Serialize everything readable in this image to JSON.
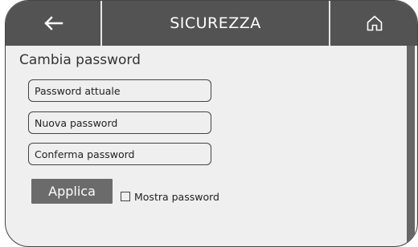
{
  "header": {
    "back_icon": "arrow-left-icon",
    "title": "SICUREZZA",
    "home_icon": "home-icon"
  },
  "section": {
    "title": "Cambia password"
  },
  "fields": {
    "current_password": {
      "placeholder": "Password attuale",
      "value": ""
    },
    "new_password": {
      "placeholder": "Nuova password",
      "value": ""
    },
    "confirm_password": {
      "placeholder": "Conferma password",
      "value": ""
    }
  },
  "actions": {
    "apply_label": "Applica",
    "show_password_label": "Mostra password",
    "show_password_checked": false
  },
  "colors": {
    "header_bg": "#535353",
    "body_bg": "#efefef",
    "button_bg": "#6b6b6b",
    "scrollbar": "#666666"
  }
}
